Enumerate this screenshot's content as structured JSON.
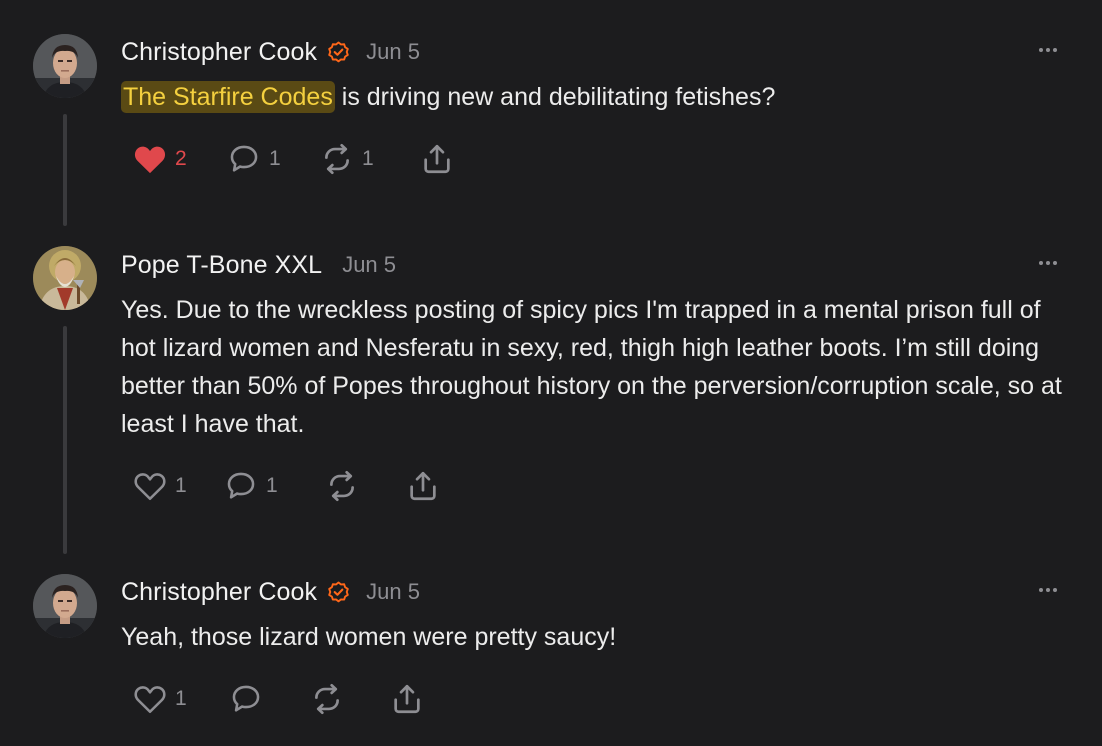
{
  "posts": [
    {
      "author": "Christopher Cook",
      "verified": true,
      "date": "Jun 5",
      "avatar_icon": "man-portrait",
      "mention": "The Starfire Codes",
      "text": " is driving new and debilitating fetishes?",
      "likes": "2",
      "liked": true,
      "replies": "1",
      "restacks": "1"
    },
    {
      "author": "Pope T-Bone XXL",
      "verified": false,
      "date": "Jun 5",
      "avatar_icon": "pope-painting",
      "text": "Yes. Due to the wreckless posting of spicy pics I'm trapped in a mental prison full of hot lizard women and Nesferatu in sexy, red, thigh high leather boots. I’m still doing better than 50% of Popes throughout history on the perversion/corruption scale, so at least I have that.",
      "likes": "1",
      "liked": false,
      "replies": "1",
      "restacks": ""
    },
    {
      "author": "Christopher Cook",
      "verified": true,
      "date": "Jun 5",
      "avatar_icon": "man-portrait",
      "text": "Yeah, those lizard women were pretty saucy!",
      "likes": "1",
      "liked": false,
      "replies": "",
      "restacks": ""
    }
  ],
  "colors": {
    "background": "#1c1c1e",
    "like_active": "#e0484c",
    "verified": "#ff6719",
    "highlight_text": "#f4d03f",
    "muted": "#8e8e93"
  }
}
